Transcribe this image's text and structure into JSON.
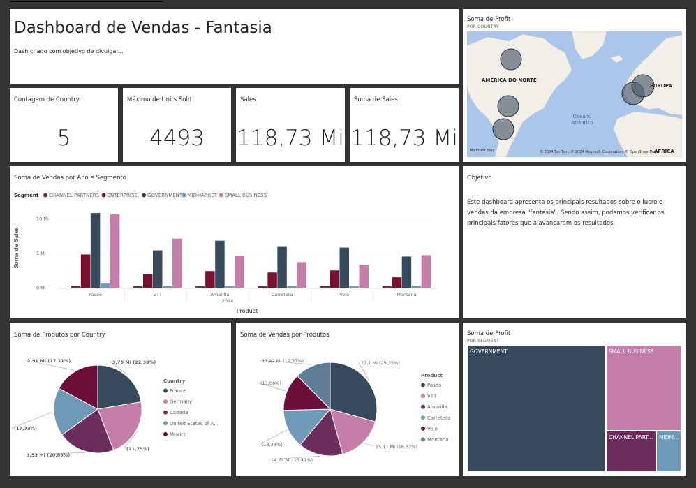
{
  "header": {
    "title": "Dashboard de Vendas - Fantasia",
    "description": "Dash criado com objetivo de divulgar..."
  },
  "kpis": [
    {
      "label": "Contagem de Country",
      "value": "5"
    },
    {
      "label": "Máximo de Units Sold",
      "value": "4493"
    },
    {
      "label": "Sales",
      "value": "118,73 Mi"
    },
    {
      "label": "Soma de Sales",
      "value": "118,73 Mi"
    }
  ],
  "map": {
    "title": "Soma de Profit",
    "subtitle": "POR COUNTRY",
    "labels": {
      "north_america": "AMÉRICA DO NORTE",
      "europe": "EUROPA",
      "africa": "ÁFRICA",
      "ocean_1": "Oceano",
      "ocean_2": "Atlântico"
    },
    "credit": "© 2024 TomTom, © 2024 Microsoft Corporation, © OpenStreetMap",
    "bing": "Microsoft Bing"
  },
  "objetivo": {
    "title": "Objetivo",
    "text": "Este dashboard apresenta os principais resultados sobre o lucro e vendas da empresa \"fantasia\". Sendo assim, podemos verificar os principais fatores que alavancaram os resultados."
  },
  "colors": {
    "channel_partners": "#6b2d5c",
    "enterprise": "#7a1030",
    "government": "#374a5c",
    "midmarket": "#6f9bb8",
    "small_business": "#c47ea8",
    "product_velo": "#6b0e3a"
  },
  "chart_data": [
    {
      "type": "bar",
      "title": "Soma de Vendas por Ano e Segmento",
      "legend_title": "Segment",
      "xlabel": "Product",
      "x_group_label": "2014",
      "ylabel": "Soma de Sales",
      "yticks": [
        "0 Mi",
        "5 Mi",
        "10 Mi"
      ],
      "ylim": [
        0,
        11
      ],
      "categories": [
        "Paseo",
        "VTT",
        "Amarilla",
        "Carretera",
        "Velo",
        "Montana"
      ],
      "series": [
        {
          "name": "CHANNEL PARTNERS",
          "color": "#6b2d5c",
          "values": [
            0.3,
            0.2,
            0.2,
            0.2,
            0.2,
            0.2
          ]
        },
        {
          "name": "ENTERPRISE",
          "color": "#7a1030",
          "values": [
            4.8,
            2.0,
            2.4,
            2.2,
            2.5,
            1.5
          ]
        },
        {
          "name": "GOVERNMENT",
          "color": "#374a5c",
          "values": [
            10.8,
            5.4,
            6.8,
            5.9,
            5.8,
            4.5
          ]
        },
        {
          "name": "MIDMARKET",
          "color": "#6f9bb8",
          "values": [
            0.6,
            0.3,
            0.2,
            0.3,
            0.2,
            0.3
          ]
        },
        {
          "name": "SMALL BUSINESS",
          "color": "#c47ea8",
          "values": [
            10.6,
            7.1,
            4.6,
            3.7,
            3.3,
            4.7
          ]
        }
      ]
    },
    {
      "type": "pie",
      "title": "Soma de Produtos por Country",
      "legend_title": "Country",
      "slices": [
        {
          "name": "France",
          "value": 22.38,
          "color": "#374a5c",
          "label": "3,78 Mi (22,38%)"
        },
        {
          "name": "Germany",
          "value": 21.79,
          "color": "#c47ea8",
          "label": "(21,79%)"
        },
        {
          "name": "Canada",
          "value": 20.89,
          "color": "#6b2d5c",
          "label": "3,53 Mi (20,89%)"
        },
        {
          "name": "United States of A...",
          "value": 17.73,
          "color": "#6f9bb8",
          "label": "(17,73%)"
        },
        {
          "name": "Mexico",
          "value": 17.21,
          "color": "#6b0e3a",
          "label": "2,91 Mi (17,21%)"
        }
      ]
    },
    {
      "type": "pie",
      "title": "Soma de Vendas por Produtos",
      "legend_title": "Product",
      "slices": [
        {
          "name": "Paseo",
          "value": 29.35,
          "color": "#374a5c",
          "label": "27,1 Mi (29,35%)"
        },
        {
          "name": "VTT",
          "value": 16.37,
          "color": "#c47ea8",
          "label": "15,11 Mi (16,37%)"
        },
        {
          "name": "Amarilla",
          "value": 15.41,
          "color": "#6b2d5c",
          "label": "14,23 Mi (15,41%)"
        },
        {
          "name": "Carretera",
          "value": 13.44,
          "color": "#6f9bb8",
          "label": "(13,44%)"
        },
        {
          "name": "Velo",
          "value": 13.06,
          "color": "#6b0e3a",
          "label": "(13,06%)"
        },
        {
          "name": "Montana",
          "value": 12.37,
          "color": "#5e7d96",
          "label": "11,42 Mi (12,37%)"
        }
      ]
    },
    {
      "type": "treemap",
      "title": "Soma de Profit",
      "subtitle": "POR SEGMENT",
      "cells": [
        {
          "name": "GOVERNMENT",
          "color": "#374a5c"
        },
        {
          "name": "SMALL BUSINESS",
          "color": "#c47ea8"
        },
        {
          "name": "CHANNEL PART...",
          "color": "#6b2d5c"
        },
        {
          "name": "MIDM...",
          "color": "#6f9bb8"
        }
      ]
    }
  ]
}
